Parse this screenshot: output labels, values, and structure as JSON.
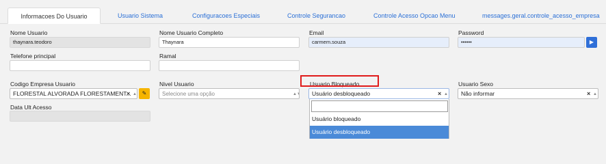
{
  "tabs": [
    "Informacoes Do Usuario",
    "Usuario Sistema",
    "Configuracoes Especiais",
    "Controle Segurancao",
    "Controle Acesso Opcao Menu",
    "messages.geral.controle_acesso_empresa"
  ],
  "fields": {
    "nome_usuario": {
      "label": "Nome Usuario",
      "value": "thaynara.teodoro"
    },
    "nome_completo": {
      "label": "Nome Usuario Completo",
      "value": "Thaynara"
    },
    "email": {
      "label": "Email",
      "value": "carmem.souza"
    },
    "password": {
      "label": "Password",
      "value": "••••••"
    },
    "telefone": {
      "label": "Telefone principal",
      "value": ""
    },
    "ramal": {
      "label": "Ramal",
      "value": ""
    },
    "codigo_empresa": {
      "label": "Codigo Empresa Usuario",
      "value": "FLORESTAL ALVORADA FLORESTAMENT..."
    },
    "nivel": {
      "label": "Nivel Usuario",
      "placeholder": "Selecione uma opção"
    },
    "bloqueado": {
      "label": "Usuario Bloqueado",
      "value": "Usuário desbloqueado"
    },
    "sexo": {
      "label": "Usuario Sexo",
      "value": "Não informar"
    },
    "data_ult": {
      "label": "Data Ult Acesso",
      "value": ""
    }
  },
  "dropdown": {
    "options": [
      "Usuário bloqueado",
      "Usuário desbloqueado"
    ],
    "selected": "Usuário desbloqueado"
  },
  "glyphs": {
    "clear": "×",
    "arrow": "▲▼"
  },
  "colors": {
    "accent": "#2f6fd8",
    "highlight": "#e01a1a",
    "selected": "#4a8ad8",
    "warning": "#f6b400"
  }
}
